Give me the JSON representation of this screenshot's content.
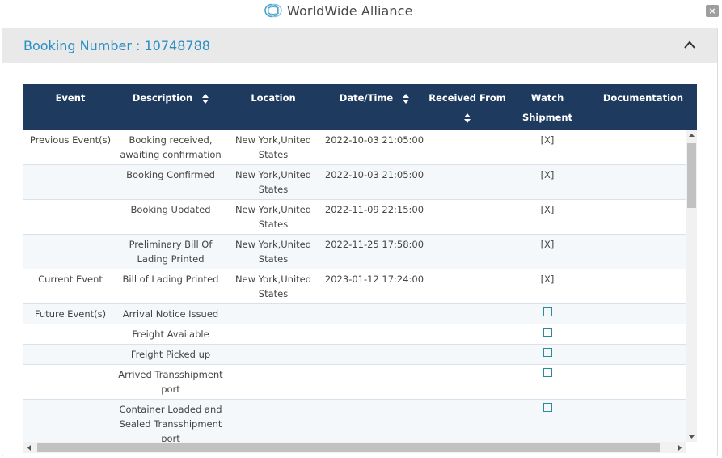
{
  "app": {
    "name": "WorldWide Alliance",
    "close_label": "×"
  },
  "panel": {
    "title": "Booking Number : 10748788"
  },
  "table": {
    "headers": {
      "event": "Event",
      "description": "Description",
      "location": "Location",
      "datetime": "Date/Time",
      "received_from": "Received From",
      "watch_line1": "Watch",
      "watch_line2": "Shipment",
      "documentation": "Documentation"
    },
    "rows": [
      {
        "event": "Previous Event(s)",
        "desc1": "Booking received,",
        "desc2": "awaiting confirmation",
        "loc1": "New York,United",
        "loc2": "States",
        "datetime": "2022-10-03 21:05:00",
        "watch": "[X]"
      },
      {
        "event": "",
        "desc1": "Booking Confirmed",
        "desc2": "",
        "loc1": "New York,United",
        "loc2": "States",
        "datetime": "2022-10-03 21:05:00",
        "watch": "[X]"
      },
      {
        "event": "",
        "desc1": "Booking Updated",
        "desc2": "",
        "loc1": "New York,United",
        "loc2": "States",
        "datetime": "2022-11-09 22:15:00",
        "watch": "[X]"
      },
      {
        "event": "",
        "desc1": "Preliminary Bill Of",
        "desc2": "Lading Printed",
        "loc1": "New York,United",
        "loc2": "States",
        "datetime": "2022-11-25 17:58:00",
        "watch": "[X]"
      },
      {
        "event": "Current Event",
        "desc1": "Bill of Lading Printed",
        "desc2": "",
        "loc1": "New York,United",
        "loc2": "States",
        "datetime": "2023-01-12 17:24:00",
        "watch": "[X]"
      },
      {
        "event": "Future Event(s)",
        "desc1": "Arrival Notice Issued",
        "desc2": "",
        "desc3": "",
        "watch_checked": false
      },
      {
        "event": "",
        "desc1": "Freight Available",
        "desc2": "",
        "desc3": "",
        "watch_checked": false
      },
      {
        "event": "",
        "desc1": "Freight Picked up",
        "desc2": "",
        "desc3": "",
        "watch_checked": false
      },
      {
        "event": "",
        "desc1": "Arrived Transshipment",
        "desc2": "port",
        "desc3": "",
        "watch_checked": false
      },
      {
        "event": "",
        "desc1": "Container Loaded and",
        "desc2": "Sealed Transshipment",
        "desc3": "port",
        "watch_checked": false
      }
    ]
  },
  "colors": {
    "header_bg": "#1e3a5f",
    "accent": "#2a8ec6",
    "checkbox": "#2a8a9a"
  }
}
